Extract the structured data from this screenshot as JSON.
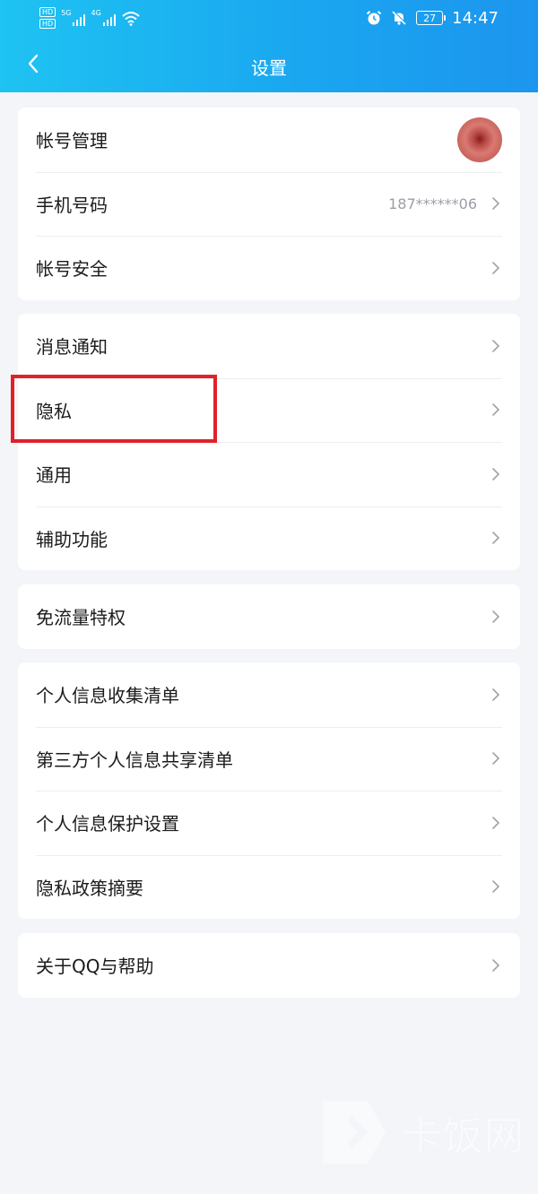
{
  "status_bar": {
    "hd1": "HD",
    "hd2": "HD",
    "sim1": "5G",
    "sim2": "4G",
    "battery": "27",
    "time": "14:47"
  },
  "header": {
    "title": "设置"
  },
  "groups": [
    {
      "items": [
        {
          "label": "帐号管理"
        },
        {
          "label": "手机号码",
          "value": "187******06"
        },
        {
          "label": "帐号安全"
        }
      ]
    },
    {
      "items": [
        {
          "label": "消息通知"
        },
        {
          "label": "隐私"
        },
        {
          "label": "通用"
        },
        {
          "label": "辅助功能"
        }
      ]
    },
    {
      "items": [
        {
          "label": "免流量特权"
        }
      ]
    },
    {
      "items": [
        {
          "label": "个人信息收集清单"
        },
        {
          "label": "第三方个人信息共享清单"
        },
        {
          "label": "个人信息保护设置"
        },
        {
          "label": "隐私政策摘要"
        }
      ]
    },
    {
      "items": [
        {
          "label": "关于QQ与帮助"
        }
      ]
    }
  ],
  "colors": {
    "header_start": "#1ec3f2",
    "header_end": "#1c95ee",
    "background": "#f4f5f9",
    "highlight": "#e0212a"
  },
  "watermark": {
    "text": "卡饭网"
  }
}
